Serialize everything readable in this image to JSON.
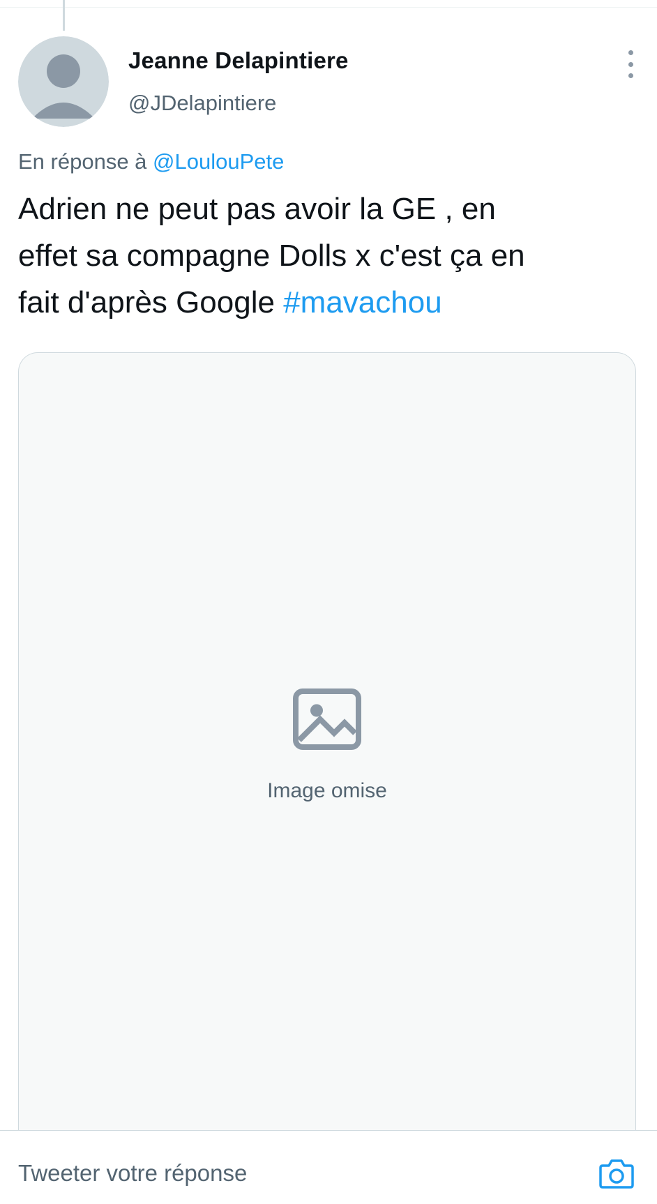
{
  "tweet": {
    "author": {
      "display_name": "Jeanne Delapintiere",
      "handle": "@JDelapintiere",
      "avatar_icon": "profile-avatar"
    },
    "reply_to": {
      "prefix": "En réponse à",
      "mention": "@LoulouPete"
    },
    "text": {
      "line_1": "Adrien ne peut pas avoir la GE , en",
      "line_2": "effet sa compagne Dolls x c'est ça en",
      "line_3_text": "fait d'après Google",
      "hashtag": "#mavachou"
    },
    "media": {
      "placeholder_text": "Image omise"
    },
    "more_icon": "more-vertical-icon"
  },
  "reply_bar": {
    "placeholder": "Tweeter votre réponse",
    "camera_icon": "camera-icon"
  },
  "colors": {
    "accent": "#1d9bf0",
    "text_primary": "#0f1419",
    "text_secondary": "#536471",
    "border": "#cfd9de"
  }
}
